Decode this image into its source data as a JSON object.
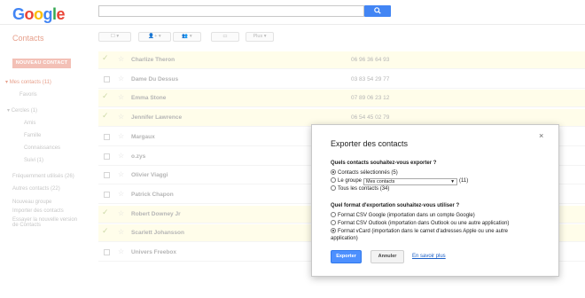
{
  "header": {
    "logo_letters": [
      {
        "ch": "G",
        "color": "#4285f4"
      },
      {
        "ch": "o",
        "color": "#ea4335"
      },
      {
        "ch": "o",
        "color": "#fbbc05"
      },
      {
        "ch": "g",
        "color": "#4285f4"
      },
      {
        "ch": "l",
        "color": "#34a853"
      },
      {
        "ch": "e",
        "color": "#ea4335"
      }
    ],
    "search_value": "",
    "search_icon": "search-icon"
  },
  "sidebar": {
    "title": "Contacts",
    "new_contact": "NOUVEAU CONTACT",
    "my_contacts": "Mes contacts (11)",
    "favorites": "Favoris",
    "circles": "Cercles (1)",
    "circle_items": [
      "Amis",
      "Famille",
      "Connaissances",
      "Suivi (1)"
    ],
    "frequent": "Fréquemment utilisés (26)",
    "other": "Autres contacts (22)",
    "new_group": "Nouveau groupe",
    "import": "Importer des contacts",
    "try_new_1": "Essayer la nouvelle version",
    "try_new_2": "de Contacts"
  },
  "toolbar": {
    "more_label": "Plus"
  },
  "contacts": [
    {
      "name": "Charlize Theron",
      "phone": "06 96 36 64 93",
      "selected": true
    },
    {
      "name": "Dame Du Dessus",
      "phone": "03 83 54 29 77",
      "selected": false
    },
    {
      "name": "Emma Stone",
      "phone": "07 89 06 23 12",
      "selected": true
    },
    {
      "name": "Jennifer Lawrence",
      "phone": "06 54 45 02 79",
      "selected": true
    },
    {
      "name": "Margaux",
      "phone": "",
      "selected": false
    },
    {
      "name": "o.zys",
      "phone": "",
      "selected": false
    },
    {
      "name": "Olivier Viaggi",
      "phone": "",
      "selected": false
    },
    {
      "name": "Patrick Chapon",
      "phone": "",
      "selected": false
    },
    {
      "name": "Robert Downey Jr",
      "phone": "",
      "selected": true
    },
    {
      "name": "Scarlett Johansson",
      "phone": "",
      "selected": true
    },
    {
      "name": "Univers Freebox",
      "phone": "",
      "selected": false
    }
  ],
  "dialog": {
    "title": "Exporter des contacts",
    "close": "×",
    "q1": "Quels contacts souhaitez-vous exporter ?",
    "opt_selected": "Contacts sélectionnés (5)",
    "opt_group_pre": "Le groupe",
    "group_value": "Mes contacts",
    "opt_group_post": "(11)",
    "opt_all": "Tous les contacts (34)",
    "q2": "Quel format d'exportation souhaitez-vous utiliser ?",
    "fmt_google": "Format CSV Google (importation dans un compte Google)",
    "fmt_outlook": "Format CSV Outlook (importation dans Outlook ou une autre application)",
    "fmt_vcard_1": "Format vCard (importation dans le carnet d'adresses Apple ou une autre",
    "fmt_vcard_2": "application)",
    "export_btn": "Exporter",
    "cancel_btn": "Annuler",
    "learn_more": "En savoir plus",
    "selected_scope": "Contacts sélectionnés (5)",
    "selected_format": "Format vCard"
  }
}
